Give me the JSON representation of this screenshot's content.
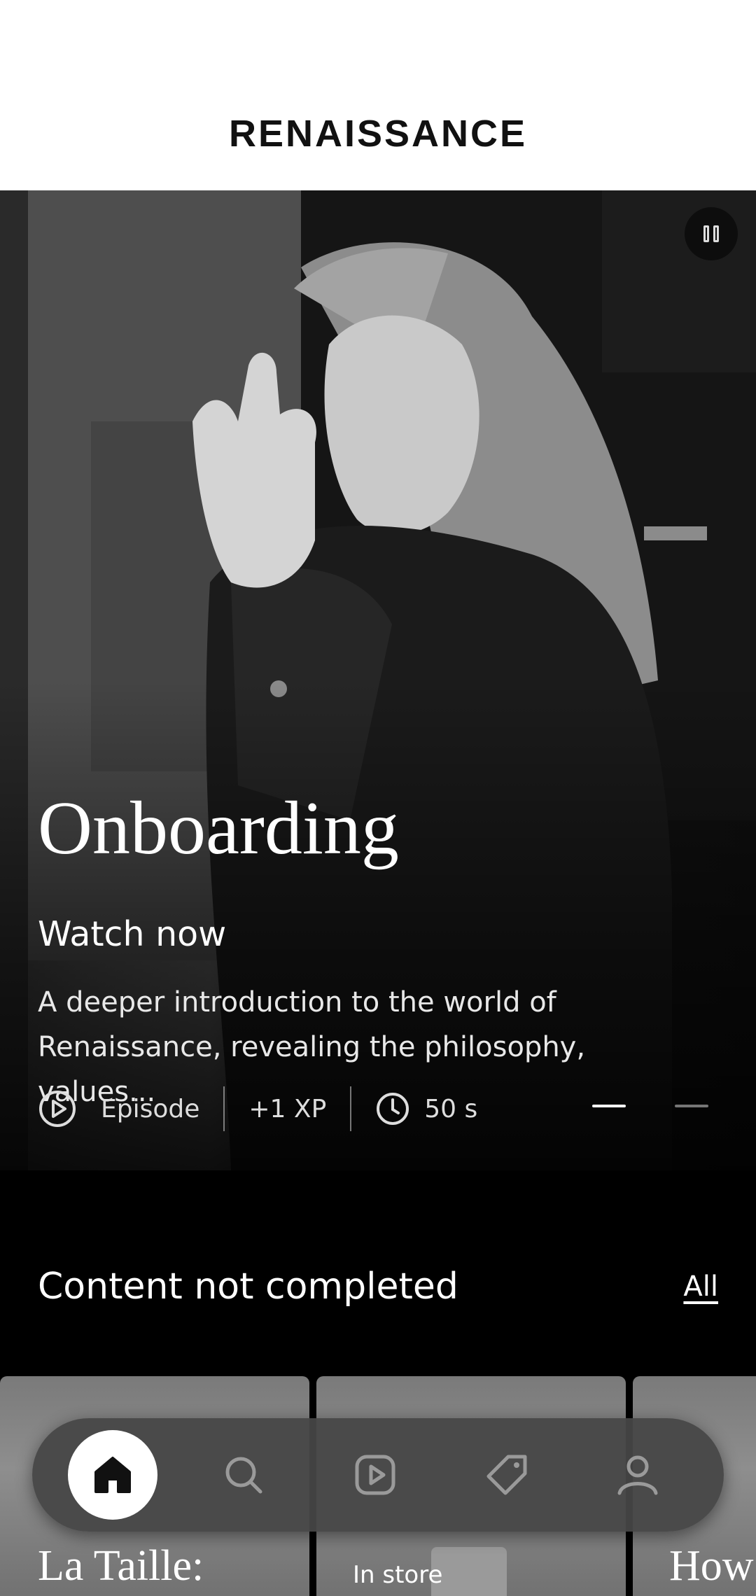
{
  "app": {
    "brand": "RENAISSANCE"
  },
  "hero": {
    "title": "Onboarding",
    "cta": "Watch now",
    "description": "A deeper introduction to the world of Renaissance, revealing the philosophy, values...",
    "meta": {
      "type": "Episode",
      "xp": "+1 XP",
      "duration": "50 s"
    },
    "pager": {
      "current": 1,
      "total": 2
    },
    "pause_icon": "pause-icon"
  },
  "section": {
    "title": "Content not completed",
    "all_link": "All"
  },
  "cards": [
    {
      "title": "La Taille:"
    },
    {
      "subtitle": "In store"
    },
    {
      "title": "How"
    }
  ],
  "nav": {
    "items": [
      {
        "name": "home",
        "icon": "home-icon",
        "active": true
      },
      {
        "name": "search",
        "icon": "search-icon",
        "active": false
      },
      {
        "name": "videos",
        "icon": "play-icon",
        "active": false
      },
      {
        "name": "offers",
        "icon": "tag-icon",
        "active": false
      },
      {
        "name": "profile",
        "icon": "user-icon",
        "active": false
      }
    ]
  },
  "colors": {
    "background": "#000000",
    "header": "#ffffff",
    "nav": "#464646",
    "accent": "#ffffff"
  }
}
